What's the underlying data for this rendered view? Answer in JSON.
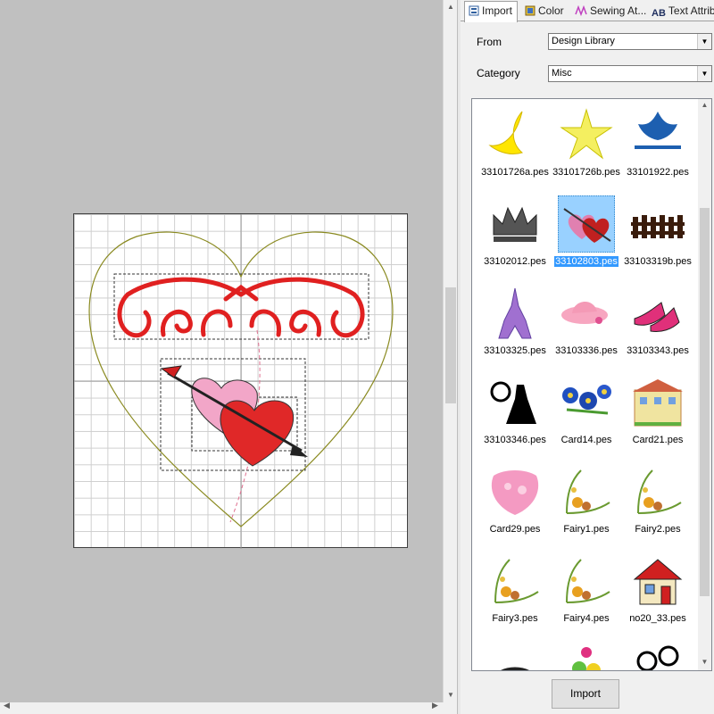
{
  "tabs": [
    {
      "label": "Import",
      "icon": "import-icon"
    },
    {
      "label": "Color",
      "icon": "color-icon"
    },
    {
      "label": "Sewing At...",
      "icon": "sewing-attributes-icon"
    },
    {
      "label": "Text Attrib...",
      "icon": "text-attributes-icon"
    }
  ],
  "from": {
    "label": "From",
    "value": "Design Library"
  },
  "category": {
    "label": "Category",
    "value": "Misc"
  },
  "library": [
    {
      "name": "33101726a.pes",
      "icon": "crescent-moon-icon"
    },
    {
      "name": "33101726b.pes",
      "icon": "star-icon"
    },
    {
      "name": "33101922.pes",
      "icon": "blue-ornament-icon"
    },
    {
      "name": "33102012.pes",
      "icon": "crown-icon"
    },
    {
      "name": "33102803.pes",
      "icon": "hearts-arrow-icon",
      "selected": true
    },
    {
      "name": "33103319b.pes",
      "icon": "fence-icon"
    },
    {
      "name": "33103325.pes",
      "icon": "eiffel-tower-icon"
    },
    {
      "name": "33103336.pes",
      "icon": "hat-icon"
    },
    {
      "name": "33103343.pes",
      "icon": "high-heels-icon"
    },
    {
      "name": "33103346.pes",
      "icon": "dress-silhouette-icon"
    },
    {
      "name": "Card14.pes",
      "icon": "blue-flowers-icon"
    },
    {
      "name": "Card21.pes",
      "icon": "house-card-icon"
    },
    {
      "name": "Card29.pes",
      "icon": "pink-lace-icon"
    },
    {
      "name": "Fairy1.pes",
      "icon": "floral-corner-icon"
    },
    {
      "name": "Fairy2.pes",
      "icon": "floral-corner-icon"
    },
    {
      "name": "Fairy3.pes",
      "icon": "floral-corner-icon"
    },
    {
      "name": "Fairy4.pes",
      "icon": "floral-corner-icon"
    },
    {
      "name": "no20_33.pes",
      "icon": "red-house-icon"
    },
    {
      "name": "",
      "icon": "rainbow-icon"
    },
    {
      "name": "",
      "icon": "balloons-icon"
    },
    {
      "name": "",
      "icon": "chef-icon"
    }
  ],
  "import_button": "Import",
  "colors": {
    "selection": "#3399ff",
    "embroidery_red": "#e02020",
    "heart_outline": "#8a8a20"
  }
}
